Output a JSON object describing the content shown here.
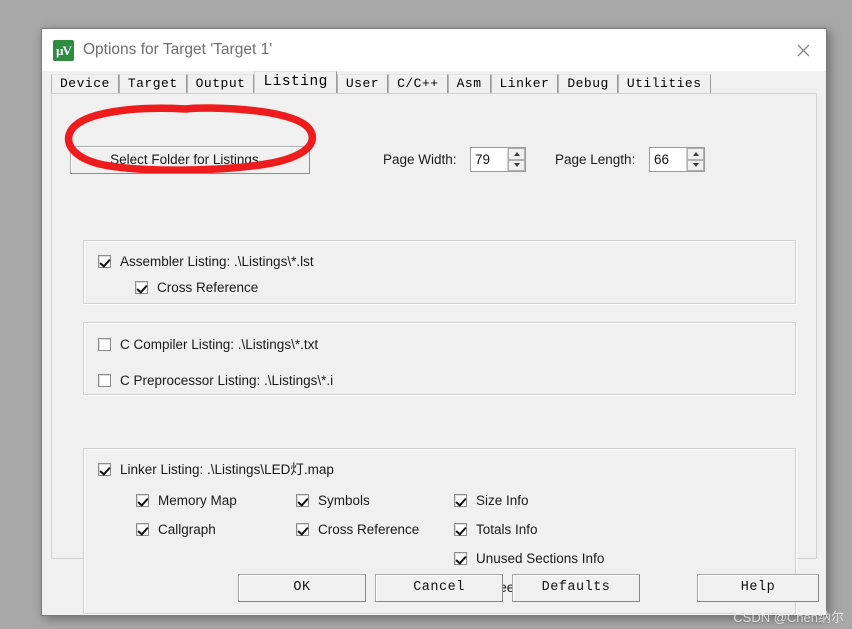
{
  "window": {
    "title": "Options for Target 'Target 1'",
    "icon": "uvision-logo-icon",
    "close_label": "close-icon"
  },
  "tabs": [
    {
      "label": "Device",
      "active": false
    },
    {
      "label": "Target",
      "active": false
    },
    {
      "label": "Output",
      "active": false
    },
    {
      "label": "Listing",
      "active": true
    },
    {
      "label": "User",
      "active": false
    },
    {
      "label": "C/C++",
      "active": false
    },
    {
      "label": "Asm",
      "active": false
    },
    {
      "label": "Linker",
      "active": false
    },
    {
      "label": "Debug",
      "active": false
    },
    {
      "label": "Utilities",
      "active": false
    }
  ],
  "listing": {
    "select_folder_label": "Select Folder for Listings...",
    "page_width_label": "Page Width:",
    "page_width_value": "79",
    "page_length_label": "Page Length:",
    "page_length_value": "66",
    "assembler": {
      "listing_label": "Assembler Listing:  .\\Listings\\*.lst",
      "listing_checked": true,
      "cross_reference_label": "Cross Reference",
      "cross_reference_checked": true
    },
    "c": {
      "compiler_label": "C Compiler Listing:  .\\Listings\\*.txt",
      "compiler_checked": false,
      "preprocessor_label": "C Preprocessor Listing:  .\\Listings\\*.i",
      "preprocessor_checked": false
    },
    "linker": {
      "listing_label": "Linker Listing:  .\\Listings\\LED灯.map",
      "listing_checked": true,
      "options": [
        {
          "label": "Memory Map",
          "checked": true,
          "col": 1,
          "row": 1
        },
        {
          "label": "Callgraph",
          "checked": true,
          "col": 1,
          "row": 2
        },
        {
          "label": "Symbols",
          "checked": true,
          "col": 2,
          "row": 1
        },
        {
          "label": "Cross Reference",
          "checked": true,
          "col": 2,
          "row": 2
        },
        {
          "label": "Size Info",
          "checked": true,
          "col": 3,
          "row": 1
        },
        {
          "label": "Totals Info",
          "checked": true,
          "col": 3,
          "row": 2
        },
        {
          "label": "Unused Sections Info",
          "checked": true,
          "col": 3,
          "row": 3
        },
        {
          "label": "Veneers Info",
          "checked": true,
          "col": 3,
          "row": 4
        }
      ]
    }
  },
  "footer": {
    "ok_label": "OK",
    "cancel_label": "Cancel",
    "defaults_label": "Defaults",
    "help_label": "Help"
  },
  "annotation": {
    "shape": "hand-drawn-ellipse",
    "color": "#ee1c1c",
    "targets": "select-folder-button"
  },
  "watermark": {
    "text": "CSDN @Chen纳尔"
  }
}
